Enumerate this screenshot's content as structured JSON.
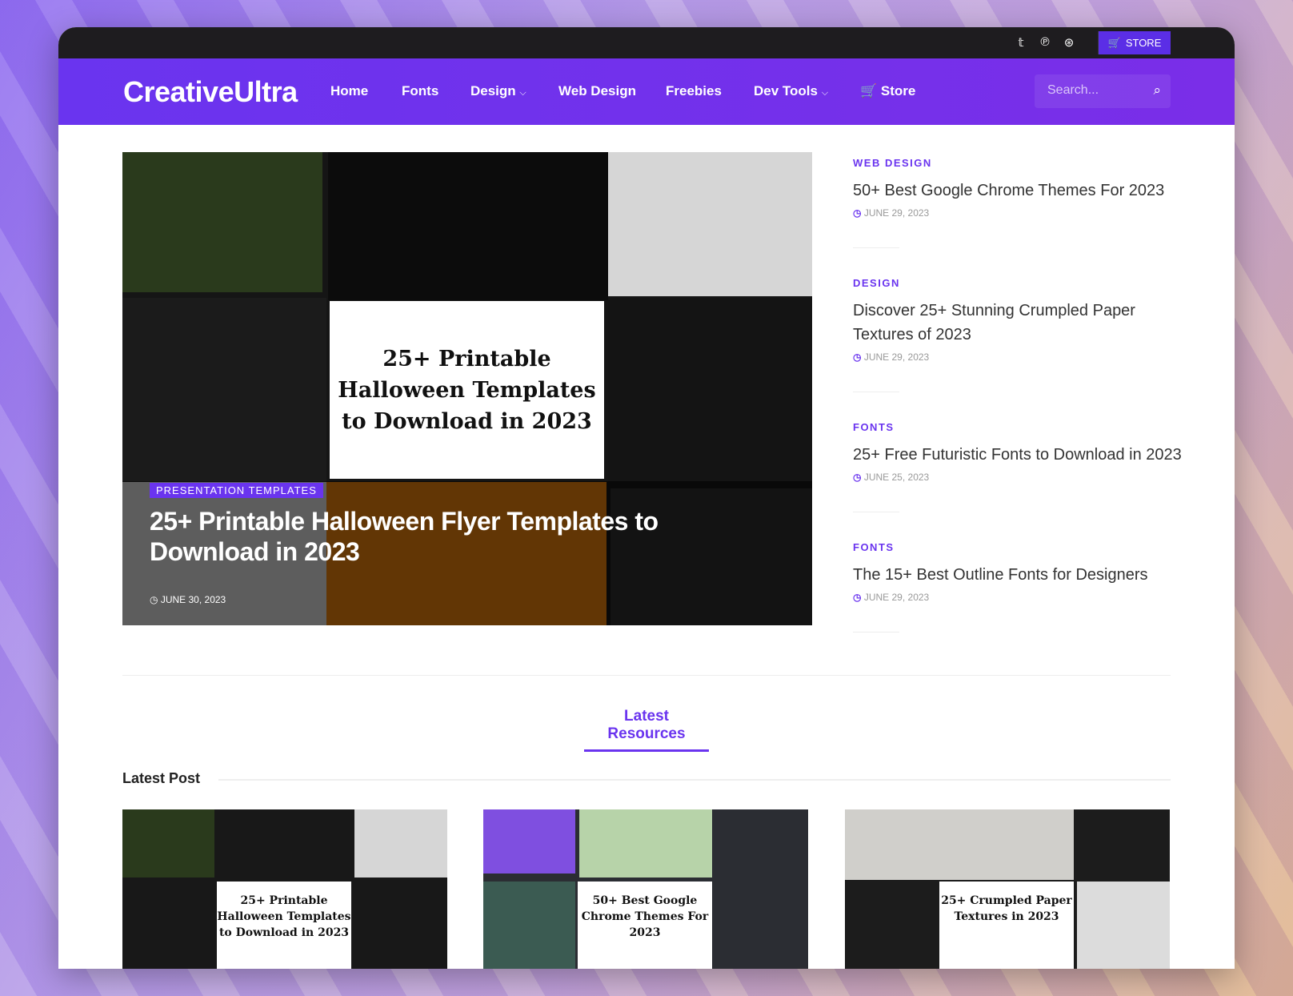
{
  "topbar": {
    "social": [
      {
        "icon": "twitter-icon",
        "glyph": "🐦"
      },
      {
        "icon": "pinterest-icon",
        "glyph": "℗"
      },
      {
        "icon": "dribbble-icon",
        "glyph": "⊛"
      }
    ],
    "store_label": "STORE"
  },
  "nav": {
    "logo": "CreativeUltra",
    "items": [
      "Home",
      "Fonts",
      "Design",
      "Web Design",
      "Freebies",
      "Dev Tools",
      "Store"
    ],
    "search_placeholder": "Search..."
  },
  "hero": {
    "image_text": "25+ Printable Halloween Templates to Download in 2023",
    "category": "PRESENTATION TEMPLATES",
    "title": "25+ Printable Halloween Flyer Templates to Download in 2023",
    "date": "JUNE 30, 2023"
  },
  "sidebar": [
    {
      "category": "WEB DESIGN",
      "title": "50+ Best Google Chrome Themes For 2023",
      "date": "JUNE 29, 2023"
    },
    {
      "category": "DESIGN",
      "title": "Discover 25+ Stunning Crumpled Paper Textures of 2023",
      "date": "JUNE 29, 2023"
    },
    {
      "category": "FONTS",
      "title": "25+ Free Futuristic Fonts to Download in 2023",
      "date": "JUNE 25, 2023"
    },
    {
      "category": "FONTS",
      "title": "The 15+ Best Outline Fonts for Designers",
      "date": "JUNE 29, 2023"
    }
  ],
  "latest_resources": "Latest Resources",
  "latest_post": "Latest Post",
  "cards": [
    {
      "image_text": "25+ Printable Halloween Templates to Download in 2023"
    },
    {
      "image_text": "50+ Best Google Chrome Themes For 2023"
    },
    {
      "image_text": "25+ Crumpled Paper Textures in 2023"
    }
  ],
  "colors": {
    "accent": "#6a34ef",
    "topbar": "#1e1c1f"
  }
}
